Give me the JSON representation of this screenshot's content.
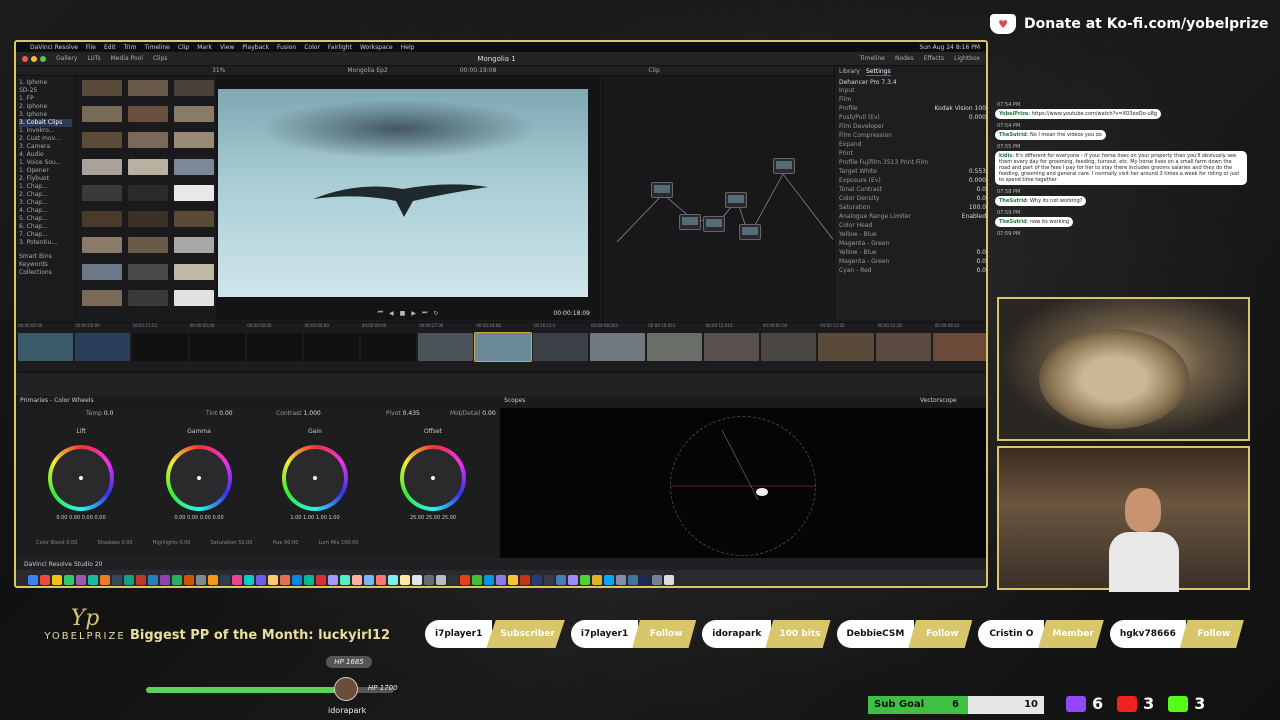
{
  "overlay": {
    "donate": "Donate at Ko-fi.com/yobelprize",
    "logo_mark": "Yp",
    "logo_word": "YOBELPRIZE",
    "biggest_pp": "Biggest PP of the Month: luckyirl123",
    "hp_badge": "HP 1685",
    "hp_max": "HP 1700",
    "hp_user": "idorapark",
    "hp_fraction": 0.99,
    "events": [
      {
        "user": "i7player1",
        "type": "Subscriber"
      },
      {
        "user": "i7player1",
        "type": "Follow"
      },
      {
        "user": "idorapark",
        "type": "100 bits"
      },
      {
        "user": "DebbieCSM",
        "type": "Follow"
      },
      {
        "user": "Cristin O",
        "type": "Member"
      },
      {
        "user": "hgkv78666",
        "type": "Follow"
      }
    ],
    "sub_goal": {
      "label": "Sub Goal",
      "current": "6",
      "target": "10"
    },
    "socials": {
      "twitch": "6",
      "youtube": "3",
      "kick": "3"
    },
    "colors": {
      "accent": "#d9c56a",
      "goal_green": "#3fbf44"
    }
  },
  "resolve": {
    "menu": [
      "DaVinci Resolve",
      "File",
      "Edit",
      "Trim",
      "Timeline",
      "Clip",
      "Mark",
      "View",
      "Playback",
      "Fusion",
      "Color",
      "Fairlight",
      "Workspace",
      "Help"
    ],
    "clock": "Sun Aug 24  8:16 PM",
    "top_tabs": [
      "Gallery",
      "LUTs",
      "Media Pool",
      "Clips"
    ],
    "project": "Mongolia 1",
    "right_tabs": [
      "Timeline",
      "Nodes",
      "Effects",
      "Lightbox"
    ],
    "zoom": "31%",
    "timeline_name": "Mongolia Ep2",
    "timecode_top": "00:00:19:08",
    "node_mode": "Clip",
    "timecode": "00:00:18:09",
    "tree": [
      "1. Iphone",
      "SD-25",
      "1. FP",
      "2. Iphone",
      "3. Iphone",
      "3. Cobalt Clips",
      "1. Invokro...",
      "2. Cust mov...",
      "3. Camera",
      "4. Audio",
      "1. Voice Sou...",
      "1. Opener",
      "2. Flybuot",
      "1. Chap...",
      "2. Chap...",
      "3. Chap...",
      "4. Chap...",
      "5. Chap...",
      "6. Chap...",
      "7. Chap...",
      "3. Potentiu..."
    ],
    "smart_bins": [
      "Smart Bins",
      "Keywords",
      "Collections"
    ],
    "settings": {
      "tabs": [
        "Library",
        "Settings"
      ],
      "plugin": "Dehancer Pro 7.3.4",
      "rows": [
        {
          "label": "Input"
        },
        {
          "label": "Film"
        },
        {
          "label": "Profile",
          "value": "Kodak Vision 100"
        },
        {
          "label": "Push/Pull (Ev)",
          "value": "0.000"
        },
        {
          "label": "Film Developer"
        },
        {
          "label": "Film Compression"
        },
        {
          "label": "Expand"
        },
        {
          "label": "Print"
        },
        {
          "label": "Profile  Fujifilm 3513 Print Film"
        },
        {
          "label": "Target White",
          "value": "0.553"
        },
        {
          "label": "Exposure (Ev)",
          "value": "0.000"
        },
        {
          "label": "Tonal Contrast",
          "value": "0.0"
        },
        {
          "label": "Color Density",
          "value": "0.0"
        },
        {
          "label": "Saturation",
          "value": "100.0"
        },
        {
          "label": "Analogue Range Limiter",
          "value": "Enabled"
        },
        {
          "label": "Color Head"
        },
        {
          "label": "Yellow - Blue"
        },
        {
          "label": "Magenta - Green"
        },
        {
          "label": "Yellow - Blue",
          "value": "0.0"
        },
        {
          "label": "Magenta - Green",
          "value": "0.0"
        },
        {
          "label": "Cyan - Red",
          "value": "0.0"
        }
      ]
    },
    "clip_timecodes": [
      "00:00:00:00",
      "00:00:00:00",
      "16:01:17:53",
      "00:00:00:00",
      "00:00:00:00",
      "00:00:00:00",
      "00:00:00:00",
      "00:00:27:36",
      "00:00:19:08",
      "16:16:15:3",
      "00:00:08:063",
      "00:00:10:053",
      "00:00:12:016",
      "00:00:01:00",
      "00:00:12:20",
      "00:00:12:28",
      "00:00:08:14"
    ],
    "clip_colors": [
      "#3a5a6a",
      "#2b3f5a",
      "#111",
      "#111",
      "#111",
      "#111",
      "#111",
      "#4a5358",
      "#6a8a98",
      "#3a4045",
      "#707880",
      "#6a6f6a",
      "#5a5050",
      "#4a4642",
      "#5a4a3a",
      "#5a4a40",
      "#6a4a38"
    ],
    "selected_clip": 8,
    "panel_title": "Primaries - Color Wheels",
    "wheel_top": [
      {
        "label": "Temp",
        "value": "0.0"
      },
      {
        "label": "Tint",
        "value": "0.00"
      },
      {
        "label": "Contrast",
        "value": "1.000"
      },
      {
        "label": "Pivot",
        "value": "0.435"
      },
      {
        "label": "Mid/Detail",
        "value": "0.00"
      }
    ],
    "wheels": [
      {
        "name": "Lift",
        "values": "0.00  0.00  0.00  0.00"
      },
      {
        "name": "Gamma",
        "values": "0.00  0.00  0.00  0.00"
      },
      {
        "name": "Gain",
        "values": "1.00  1.00  1.00  1.00"
      },
      {
        "name": "Offset",
        "values": "25.00  25.00  25.00"
      }
    ],
    "wheel_bottom": [
      {
        "label": "Color Boost",
        "value": "0.00"
      },
      {
        "label": "Shadows",
        "value": "0.00"
      },
      {
        "label": "Highlights",
        "value": "0.00"
      },
      {
        "label": "Saturation",
        "value": "50.00"
      },
      {
        "label": "Hue",
        "value": "50.00"
      },
      {
        "label": "Lum Mix",
        "value": "100.00"
      }
    ],
    "scopes": {
      "title": "Scopes",
      "mode": "Vectorscope"
    },
    "app_name": "DaVinci Resolve Studio 20",
    "thumb_colors": [
      "#5a4a3c",
      "#6a5a4a",
      "#4a4038",
      "#7a6a58",
      "#6a5040",
      "#8a7a68",
      "#5c4c3a",
      "#7a6a5a",
      "#9a8a78",
      "#a8a29a",
      "#b8b0a0",
      "#7a8898",
      "#3a3a3a",
      "#2a2a2a",
      "#e8e8e8",
      "#4a3a2a",
      "#3a3028",
      "#5a4a38",
      "#8a7a6a",
      "#6a5a48",
      "#a8a8a8",
      "#6a7888",
      "#4a4a48",
      "#c0b8a8",
      "#7a6a5a",
      "#3a3a3a",
      "#e0e0e0"
    ],
    "dock_colors": [
      "#3b82f6",
      "#e74c3c",
      "#f1c40f",
      "#2ecc71",
      "#9b59b6",
      "#1abc9c",
      "#e67e22",
      "#34495e",
      "#16a085",
      "#c0392b",
      "#2980b9",
      "#8e44ad",
      "#27ae60",
      "#d35400",
      "#7f8c8d",
      "#f39c12",
      "#2c3e50",
      "#e84393",
      "#00cec9",
      "#6c5ce7",
      "#fdcb6e",
      "#e17055",
      "#0984e3",
      "#00b894",
      "#d63031",
      "#a29bfe",
      "#55efc4",
      "#fab1a0",
      "#74b9ff",
      "#ff7675",
      "#81ecec",
      "#ffeaa7",
      "#dfe6e9",
      "#636e72",
      "#b2bec3",
      "#2d3436",
      "#e84118",
      "#44bd32",
      "#0097e6",
      "#8c7ae6",
      "#fbc531",
      "#c23616",
      "#273c75",
      "#353b48",
      "#487eb0",
      "#9c88ff",
      "#4cd137",
      "#e1b12c",
      "#00a8ff",
      "#7f8fa6",
      "#40739e",
      "#192a56",
      "#718093",
      "#dcdde1"
    ]
  },
  "chat": [
    {
      "time": "07:54 PM",
      "user": "YobelPrize",
      "text": "https://www.youtube.com/watch?v=XO3eoDo-u8g"
    },
    {
      "time": "",
      "user": "",
      "text": ""
    },
    {
      "time": "07:54 PM",
      "user": "TheSutrid",
      "text": "No I mean the videos you do"
    },
    {
      "time": "07:55 PM",
      "user": "kidis",
      "text": "It's different for everyone - if your horse lives on your property then you'll obviously see them every day for grooming, feeding, turnout, etc. My horse lives on a small farm down the road and part of the fees I pay for her to stay there includes grooms salaries and they do the feeding, grooming and general care. I normally visit her around 3 times a week for riding or just to spend time together"
    },
    {
      "time": "07:58 PM",
      "user": "TheSutrid",
      "text": "Why its not working?"
    },
    {
      "time": "07:59 PM",
      "user": "TheSutrid",
      "text": "now its working"
    },
    {
      "time": "07:59 PM",
      "user": "",
      "text": ""
    }
  ]
}
